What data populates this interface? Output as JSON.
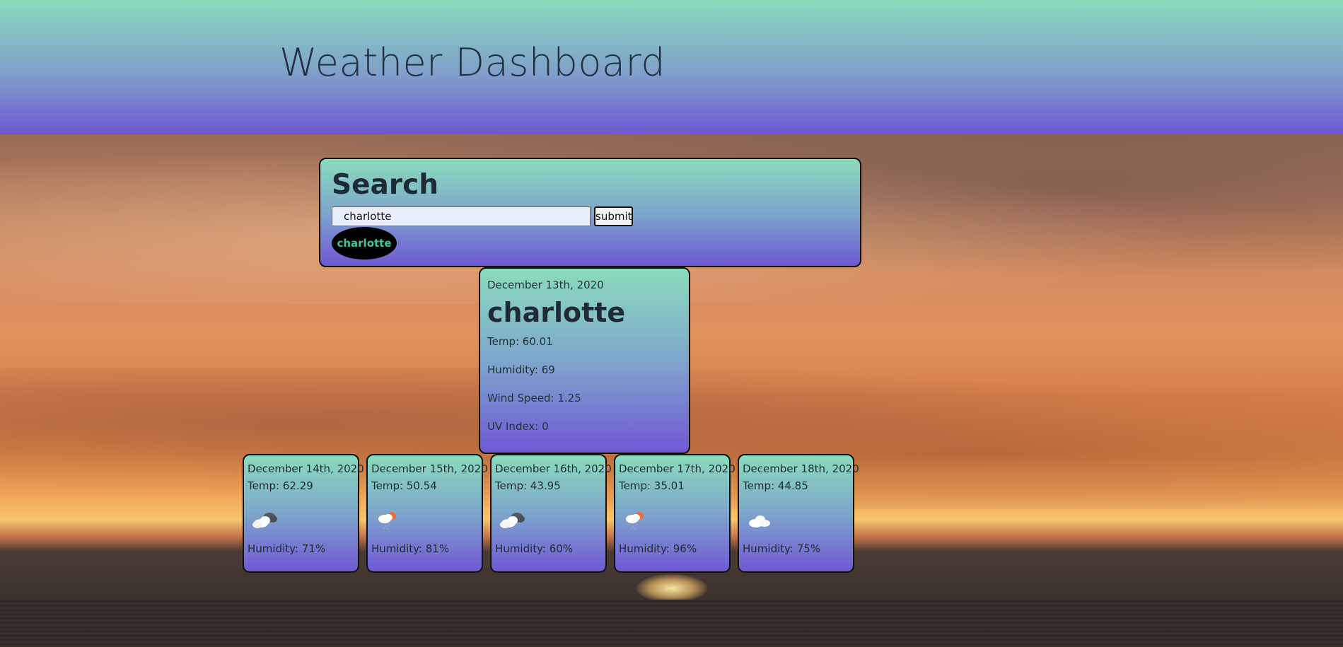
{
  "header": {
    "title": "Weather Dashboard"
  },
  "search": {
    "title": "Search",
    "input_value": "charlotte",
    "submit_label": "submit",
    "history": [
      "charlotte"
    ]
  },
  "current": {
    "date": "December 13th, 2020",
    "city": "charlotte",
    "temp": "Temp: 60.01",
    "humidity": "Humidity: 69",
    "wind": "Wind Speed: 1.25",
    "uv": "UV Index: 0"
  },
  "forecast": [
    {
      "date": "December 14th, 2020",
      "temp": "Temp: 62.29",
      "icon": "partly-cloudy-icon",
      "humidity": "Humidity: 71%"
    },
    {
      "date": "December 15th, 2020",
      "temp": "Temp: 50.54",
      "icon": "rain-sun-icon",
      "humidity": "Humidity: 81%"
    },
    {
      "date": "December 16th, 2020",
      "temp": "Temp: 43.95",
      "icon": "partly-cloudy-icon",
      "humidity": "Humidity: 60%"
    },
    {
      "date": "December 17th, 2020",
      "temp": "Temp: 35.01",
      "icon": "rain-sun-icon",
      "humidity": "Humidity: 96%"
    },
    {
      "date": "December 18th, 2020",
      "temp": "Temp: 44.85",
      "icon": "cloud-icon",
      "humidity": "Humidity: 75%"
    }
  ]
}
